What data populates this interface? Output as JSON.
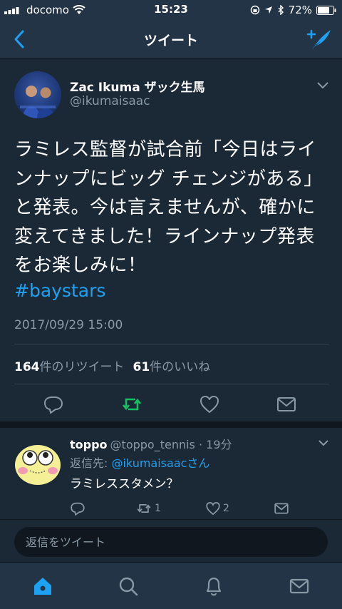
{
  "status_bar": {
    "carrier": "docomo",
    "time": "15:23",
    "battery": "72%"
  },
  "nav": {
    "title": "ツイート",
    "back_icon": "chevron-left-icon",
    "compose_icon": "compose-tweet-icon"
  },
  "tweet": {
    "author_name": "Zac Ikuma ザック生馬",
    "author_handle": "@ikumaisaac",
    "text": "ラミレス監督が試合前「今日はラインナップにビッグ チェンジがある」と発表。今は言えませんが、確かに変えてきました！ラインナップ発表をお楽しみに！",
    "hashtag": "#baystars",
    "timestamp": "2017/09/29 15:00",
    "retweet_count": "164",
    "retweet_label": "件のリツイート",
    "like_count": "61",
    "like_label": "件のいいね"
  },
  "reply": {
    "name": "toppo",
    "handle": "@toppo_tennis",
    "time": "· 19分",
    "reply_to_label": "返信先: ",
    "reply_to_user": "@ikumaisaacさん",
    "text": "ラミレススタメン？",
    "retweet_count": "1",
    "like_count": "2"
  },
  "compose": {
    "placeholder": "返信をツイート"
  },
  "colors": {
    "background": "#1b2836",
    "bar": "#243447",
    "accent": "#1da1f2",
    "retweet_green": "#17bf63",
    "muted": "#8899a6"
  }
}
